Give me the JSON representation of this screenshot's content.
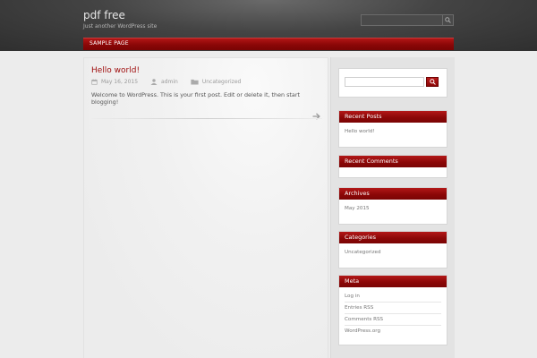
{
  "site": {
    "title": "pdf free",
    "tagline": "Just another WordPress site"
  },
  "nav": {
    "items": [
      {
        "label": "SAMPLE PAGE"
      }
    ]
  },
  "post": {
    "title": "Hello world!",
    "date": "May 16, 2015",
    "author": "admin",
    "category": "Uncategorized",
    "excerpt": "Welcome to WordPress. This is your first post. Edit or delete it, then start blogging!"
  },
  "sidebar": {
    "widgets": [
      {
        "title": "Recent Posts",
        "items": [
          "Hello world!"
        ]
      },
      {
        "title": "Recent Comments",
        "items": []
      },
      {
        "title": "Archives",
        "items": [
          "May 2015"
        ]
      },
      {
        "title": "Categories",
        "items": [
          "Uncategorized"
        ]
      },
      {
        "title": "Meta",
        "items": [
          "Log in",
          "Entries RSS",
          "Comments RSS",
          "WordPress.org"
        ]
      }
    ]
  },
  "colors": {
    "accent": "#9e0d0d",
    "header_bg": "#3a3a3a",
    "page_bg": "#ececec"
  },
  "icons": {
    "date": "calendar-icon",
    "author": "user-icon",
    "category": "folder-icon",
    "more": "arrow-right-icon",
    "search": "search-icon"
  }
}
